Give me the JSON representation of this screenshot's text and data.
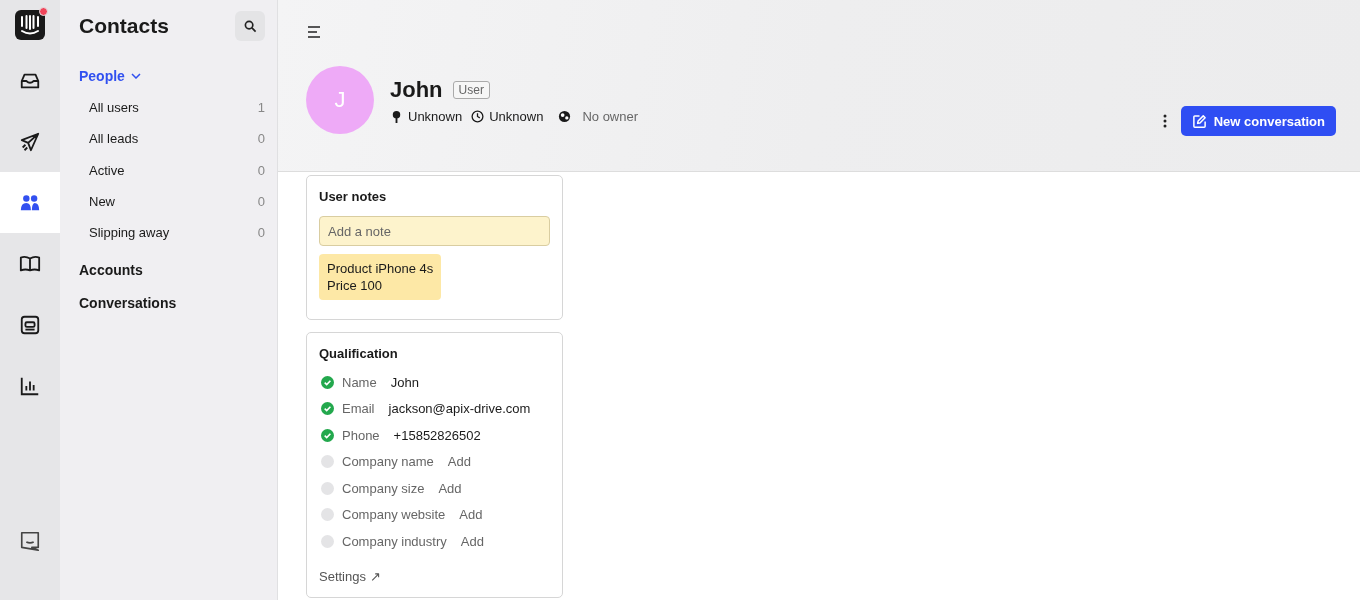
{
  "rail": {
    "items": [
      {
        "kind": "inbox",
        "selected": false
      },
      {
        "kind": "send",
        "selected": false
      },
      {
        "kind": "people",
        "selected": true
      },
      {
        "kind": "book",
        "selected": false
      },
      {
        "kind": "card",
        "selected": false
      },
      {
        "kind": "chart",
        "selected": false
      }
    ],
    "logo_badge": true
  },
  "nav": {
    "title": "Contacts",
    "section": {
      "label": "People",
      "expanded": true,
      "items": [
        {
          "label": "All users",
          "count": "1"
        },
        {
          "label": "All leads",
          "count": "0"
        },
        {
          "label": "Active",
          "count": "0"
        },
        {
          "label": "New",
          "count": "0"
        },
        {
          "label": "Slipping away",
          "count": "0"
        }
      ]
    },
    "links": [
      "Accounts",
      "Conversations"
    ]
  },
  "profile": {
    "initial": "J",
    "name": "John",
    "badge": "User",
    "location": "Unknown",
    "time": "Unknown",
    "owner": "No owner",
    "button": "New conversation"
  },
  "notes": {
    "title": "User notes",
    "placeholder": "Add a note",
    "note_lines": [
      "Product iPhone 4s",
      "Price 100"
    ]
  },
  "qualification": {
    "title": "Qualification",
    "rows": [
      {
        "label": "Name",
        "value": "John",
        "done": true,
        "kind": "value"
      },
      {
        "label": "Email",
        "value": "jackson@apix-drive.com",
        "done": true,
        "kind": "value"
      },
      {
        "label": "Phone",
        "value": "+15852826502",
        "done": true,
        "kind": "value"
      },
      {
        "label": "Company name",
        "value": "Add",
        "done": false,
        "kind": "add"
      },
      {
        "label": "Company size",
        "value": "Add",
        "done": false,
        "kind": "add"
      },
      {
        "label": "Company website",
        "value": "Add",
        "done": false,
        "kind": "add"
      },
      {
        "label": "Company industry",
        "value": "Add",
        "done": false,
        "kind": "add"
      }
    ],
    "settings": "Settings ↗"
  }
}
